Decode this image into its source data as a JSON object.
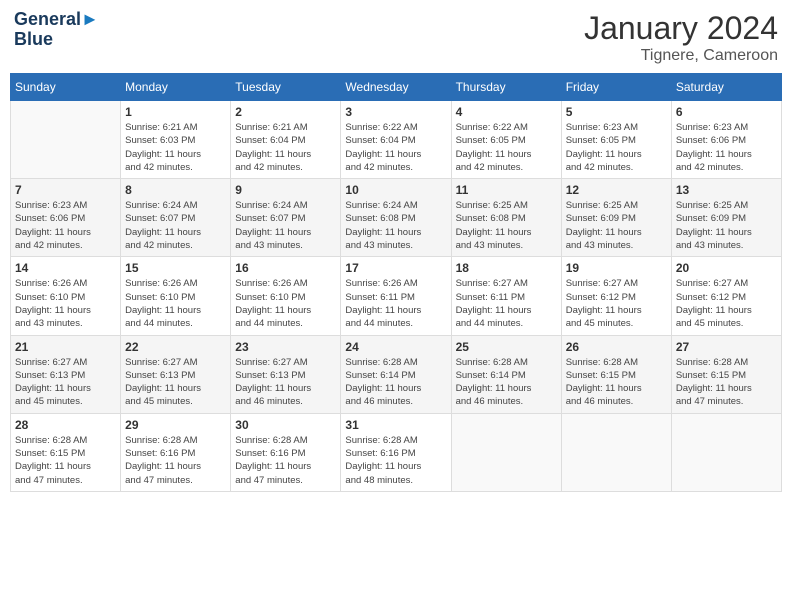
{
  "header": {
    "logo_line1": "General",
    "logo_line2": "Blue",
    "month_title": "January 2024",
    "location": "Tignere, Cameroon"
  },
  "days_of_week": [
    "Sunday",
    "Monday",
    "Tuesday",
    "Wednesday",
    "Thursday",
    "Friday",
    "Saturday"
  ],
  "weeks": [
    [
      {
        "day": "",
        "info": ""
      },
      {
        "day": "1",
        "info": "Sunrise: 6:21 AM\nSunset: 6:03 PM\nDaylight: 11 hours\nand 42 minutes."
      },
      {
        "day": "2",
        "info": "Sunrise: 6:21 AM\nSunset: 6:04 PM\nDaylight: 11 hours\nand 42 minutes."
      },
      {
        "day": "3",
        "info": "Sunrise: 6:22 AM\nSunset: 6:04 PM\nDaylight: 11 hours\nand 42 minutes."
      },
      {
        "day": "4",
        "info": "Sunrise: 6:22 AM\nSunset: 6:05 PM\nDaylight: 11 hours\nand 42 minutes."
      },
      {
        "day": "5",
        "info": "Sunrise: 6:23 AM\nSunset: 6:05 PM\nDaylight: 11 hours\nand 42 minutes."
      },
      {
        "day": "6",
        "info": "Sunrise: 6:23 AM\nSunset: 6:06 PM\nDaylight: 11 hours\nand 42 minutes."
      }
    ],
    [
      {
        "day": "7",
        "info": "Sunrise: 6:23 AM\nSunset: 6:06 PM\nDaylight: 11 hours\nand 42 minutes."
      },
      {
        "day": "8",
        "info": "Sunrise: 6:24 AM\nSunset: 6:07 PM\nDaylight: 11 hours\nand 42 minutes."
      },
      {
        "day": "9",
        "info": "Sunrise: 6:24 AM\nSunset: 6:07 PM\nDaylight: 11 hours\nand 43 minutes."
      },
      {
        "day": "10",
        "info": "Sunrise: 6:24 AM\nSunset: 6:08 PM\nDaylight: 11 hours\nand 43 minutes."
      },
      {
        "day": "11",
        "info": "Sunrise: 6:25 AM\nSunset: 6:08 PM\nDaylight: 11 hours\nand 43 minutes."
      },
      {
        "day": "12",
        "info": "Sunrise: 6:25 AM\nSunset: 6:09 PM\nDaylight: 11 hours\nand 43 minutes."
      },
      {
        "day": "13",
        "info": "Sunrise: 6:25 AM\nSunset: 6:09 PM\nDaylight: 11 hours\nand 43 minutes."
      }
    ],
    [
      {
        "day": "14",
        "info": "Sunrise: 6:26 AM\nSunset: 6:10 PM\nDaylight: 11 hours\nand 43 minutes."
      },
      {
        "day": "15",
        "info": "Sunrise: 6:26 AM\nSunset: 6:10 PM\nDaylight: 11 hours\nand 44 minutes."
      },
      {
        "day": "16",
        "info": "Sunrise: 6:26 AM\nSunset: 6:10 PM\nDaylight: 11 hours\nand 44 minutes."
      },
      {
        "day": "17",
        "info": "Sunrise: 6:26 AM\nSunset: 6:11 PM\nDaylight: 11 hours\nand 44 minutes."
      },
      {
        "day": "18",
        "info": "Sunrise: 6:27 AM\nSunset: 6:11 PM\nDaylight: 11 hours\nand 44 minutes."
      },
      {
        "day": "19",
        "info": "Sunrise: 6:27 AM\nSunset: 6:12 PM\nDaylight: 11 hours\nand 45 minutes."
      },
      {
        "day": "20",
        "info": "Sunrise: 6:27 AM\nSunset: 6:12 PM\nDaylight: 11 hours\nand 45 minutes."
      }
    ],
    [
      {
        "day": "21",
        "info": "Sunrise: 6:27 AM\nSunset: 6:13 PM\nDaylight: 11 hours\nand 45 minutes."
      },
      {
        "day": "22",
        "info": "Sunrise: 6:27 AM\nSunset: 6:13 PM\nDaylight: 11 hours\nand 45 minutes."
      },
      {
        "day": "23",
        "info": "Sunrise: 6:27 AM\nSunset: 6:13 PM\nDaylight: 11 hours\nand 46 minutes."
      },
      {
        "day": "24",
        "info": "Sunrise: 6:28 AM\nSunset: 6:14 PM\nDaylight: 11 hours\nand 46 minutes."
      },
      {
        "day": "25",
        "info": "Sunrise: 6:28 AM\nSunset: 6:14 PM\nDaylight: 11 hours\nand 46 minutes."
      },
      {
        "day": "26",
        "info": "Sunrise: 6:28 AM\nSunset: 6:15 PM\nDaylight: 11 hours\nand 46 minutes."
      },
      {
        "day": "27",
        "info": "Sunrise: 6:28 AM\nSunset: 6:15 PM\nDaylight: 11 hours\nand 47 minutes."
      }
    ],
    [
      {
        "day": "28",
        "info": "Sunrise: 6:28 AM\nSunset: 6:15 PM\nDaylight: 11 hours\nand 47 minutes."
      },
      {
        "day": "29",
        "info": "Sunrise: 6:28 AM\nSunset: 6:16 PM\nDaylight: 11 hours\nand 47 minutes."
      },
      {
        "day": "30",
        "info": "Sunrise: 6:28 AM\nSunset: 6:16 PM\nDaylight: 11 hours\nand 47 minutes."
      },
      {
        "day": "31",
        "info": "Sunrise: 6:28 AM\nSunset: 6:16 PM\nDaylight: 11 hours\nand 48 minutes."
      },
      {
        "day": "",
        "info": ""
      },
      {
        "day": "",
        "info": ""
      },
      {
        "day": "",
        "info": ""
      }
    ]
  ]
}
